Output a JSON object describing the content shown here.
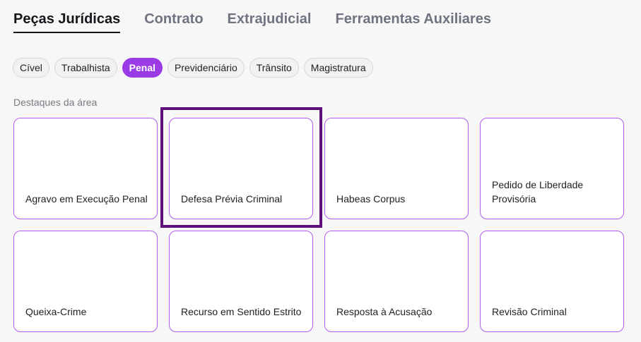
{
  "tabs": [
    {
      "label": "Peças Jurídicas",
      "active": true
    },
    {
      "label": "Contrato",
      "active": false
    },
    {
      "label": "Extrajudicial",
      "active": false
    },
    {
      "label": "Ferramentas Auxiliares",
      "active": false
    }
  ],
  "chips": [
    {
      "label": "Cível",
      "active": false
    },
    {
      "label": "Trabalhista",
      "active": false
    },
    {
      "label": "Penal",
      "active": true
    },
    {
      "label": "Previdenciário",
      "active": false
    },
    {
      "label": "Trânsito",
      "active": false
    },
    {
      "label": "Magistratura",
      "active": false
    }
  ],
  "section_label": "Destaques da área",
  "cards": [
    {
      "title": "Agravo em Execução Penal"
    },
    {
      "title": "Defesa Prévia Criminal"
    },
    {
      "title": "Habeas Corpus"
    },
    {
      "title": "Pedido de Liberdade Provisória"
    },
    {
      "title": "Queixa-Crime"
    },
    {
      "title": "Recurso em Sentido Estrito"
    },
    {
      "title": "Resposta à Acusação"
    },
    {
      "title": "Revisão Criminal"
    }
  ],
  "colors": {
    "accent": "#9b3be6",
    "card_border": "#b25cf0",
    "highlight_border": "#5f0f7c"
  }
}
